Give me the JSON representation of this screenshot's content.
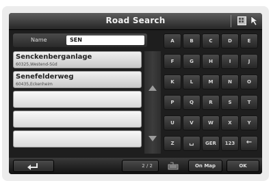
{
  "window": {
    "title": "Road Search"
  },
  "titlebar": {
    "icons": [
      "keyboard-grid-icon",
      "cursor-arrow-icon"
    ]
  },
  "search": {
    "label": "Name",
    "value": "SEN"
  },
  "results": [
    {
      "street": "Senckenberganlage",
      "district": "60325,Westend-Süd"
    },
    {
      "street": "Senefelderweg",
      "district": "60435,Eckenheim"
    },
    {
      "street": "",
      "district": ""
    },
    {
      "street": "",
      "district": ""
    },
    {
      "street": "",
      "district": ""
    }
  ],
  "keyboard": {
    "rows": [
      [
        "A",
        "B",
        "C",
        "D",
        "E"
      ],
      [
        "F",
        "G",
        "H",
        "I",
        "J"
      ],
      [
        "K",
        "L",
        "M",
        "N",
        "O"
      ],
      [
        "P",
        "Q",
        "R",
        "S",
        "T"
      ],
      [
        "U",
        "V",
        "W",
        "X",
        "Y"
      ],
      [
        "Z",
        "␣",
        "GER",
        "123",
        "←"
      ]
    ]
  },
  "bottom": {
    "back_icon": "back-arrow-icon",
    "page_indicator": "2 / 2",
    "on_map_label": "On Map",
    "ok_label": "OK"
  }
}
